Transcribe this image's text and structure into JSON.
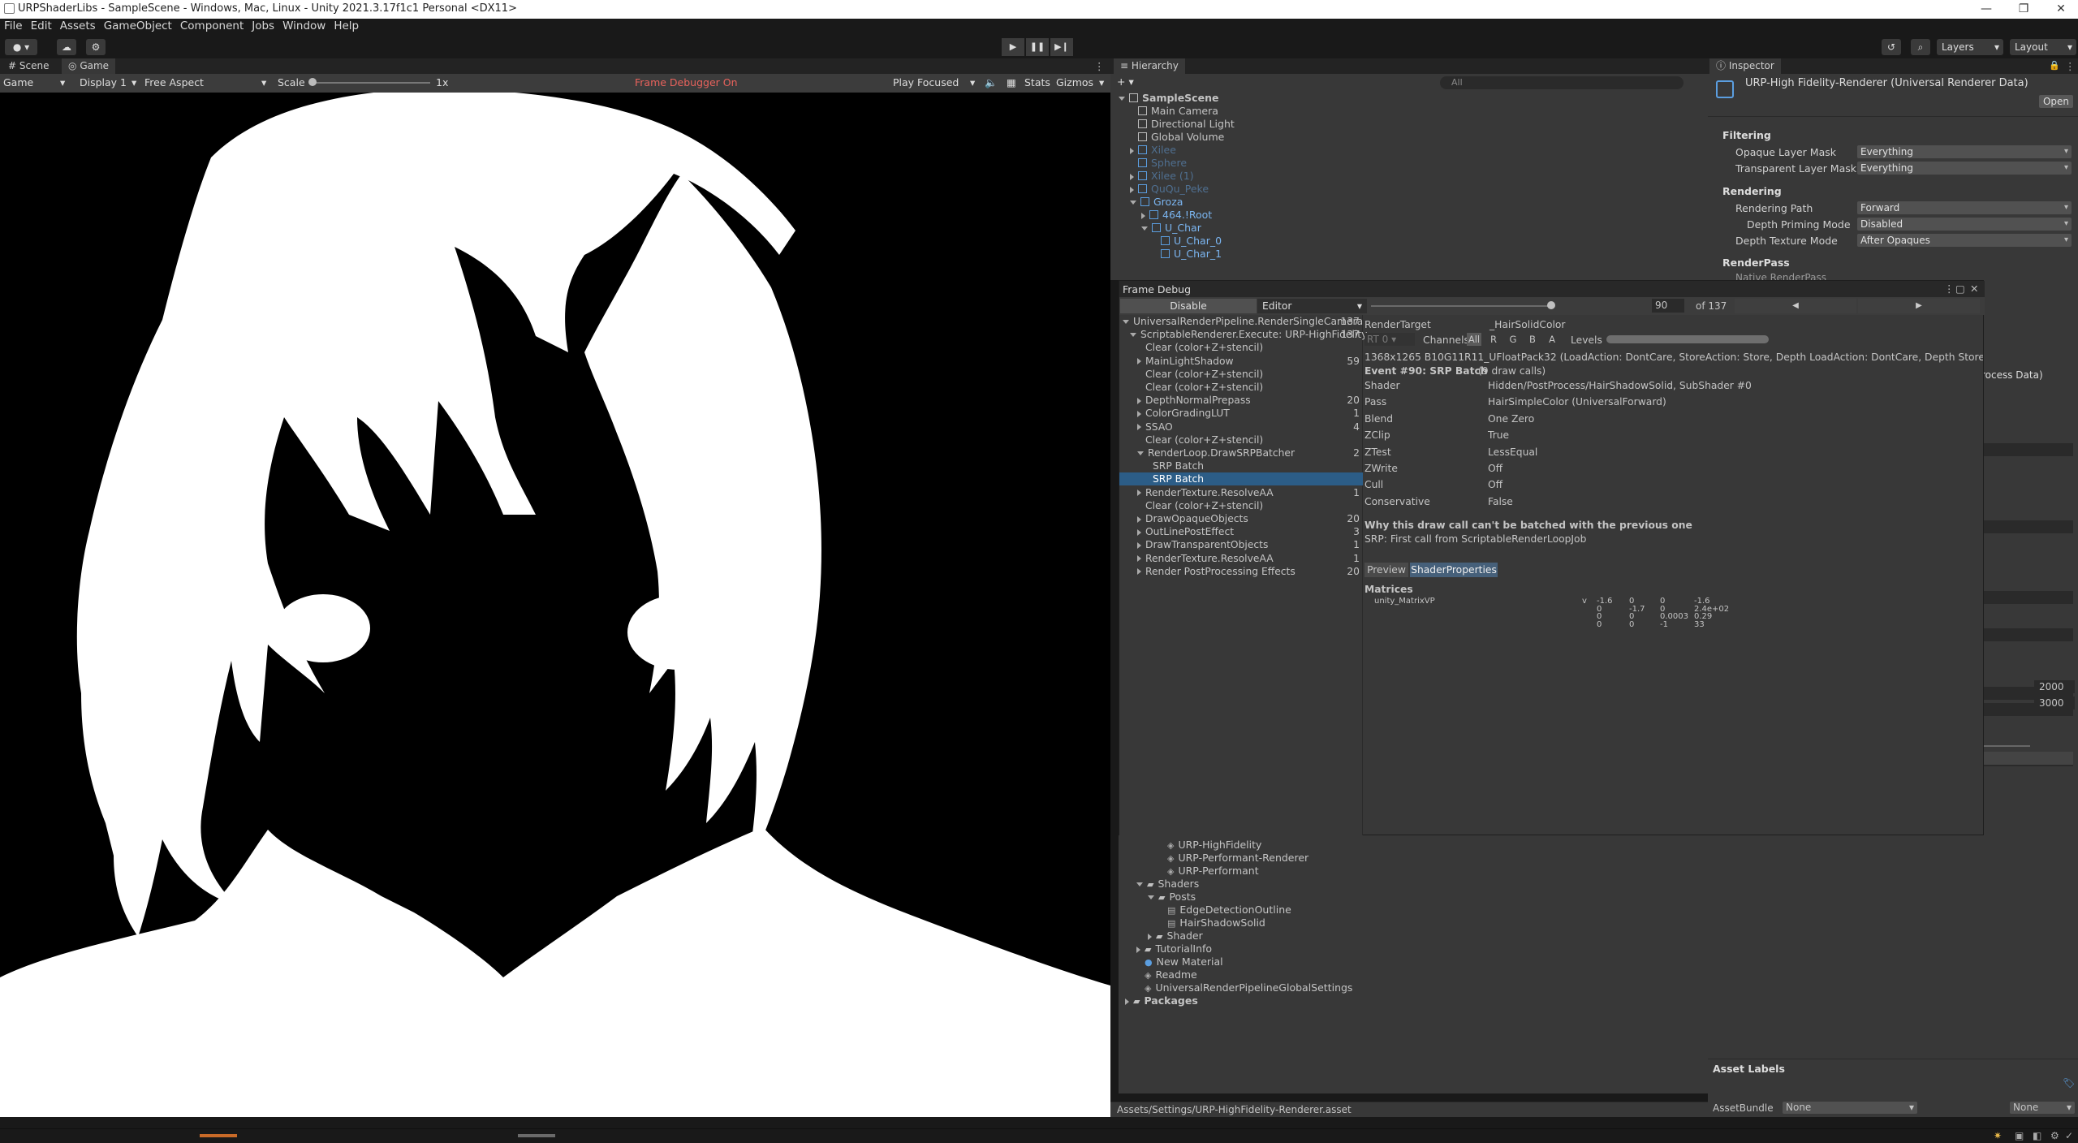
{
  "window": {
    "title": "URPShaderLibs - SampleScene - Windows, Mac, Linux - Unity 2021.3.17f1c1 Personal <DX11>"
  },
  "menu": [
    "File",
    "Edit",
    "Assets",
    "GameObject",
    "Component",
    "Jobs",
    "Window",
    "Help"
  ],
  "toolbar": {
    "layers": "Layers",
    "layout": "Layout"
  },
  "tabs": {
    "scene": "Scene",
    "game": "Game",
    "hierarchy": "Hierarchy",
    "inspector": "Inspector"
  },
  "gamebar": {
    "mode": "Game",
    "display": "Display 1",
    "aspect": "Free Aspect",
    "scale_label": "Scale",
    "scale_value": "1x",
    "frame_debugger": "Frame Debugger On",
    "play_focused": "Play Focused",
    "stats": "Stats",
    "gizmos": "Gizmos"
  },
  "hierarchy": {
    "search_placeholder": "All",
    "items": [
      {
        "label": "SampleScene",
        "depth": 0,
        "bold": true,
        "expanded": true
      },
      {
        "label": "Main Camera",
        "depth": 1
      },
      {
        "label": "Directional Light",
        "depth": 1
      },
      {
        "label": "Global Volume",
        "depth": 1
      },
      {
        "label": "Xilee",
        "depth": 1,
        "dim": true,
        "arrow": true
      },
      {
        "label": "Sphere",
        "depth": 1,
        "dim": true
      },
      {
        "label": "Xilee (1)",
        "depth": 1,
        "dim": true,
        "arrow": true
      },
      {
        "label": "QuQu_Peke",
        "depth": 1,
        "dim": true,
        "arrow": true
      },
      {
        "label": "Groza",
        "depth": 1,
        "blue": true,
        "expanded": true
      },
      {
        "label": "464.!Root",
        "depth": 2,
        "blue": true,
        "arrow": true
      },
      {
        "label": "U_Char",
        "depth": 2,
        "blue": true,
        "expanded": true
      },
      {
        "label": "U_Char_0",
        "depth": 3,
        "blue": true
      },
      {
        "label": "U_Char_1",
        "depth": 3,
        "blue": true
      }
    ]
  },
  "inspector": {
    "title": "URP-High Fidelity-Renderer (Universal Renderer Data)",
    "open": "Open",
    "filtering": "Filtering",
    "opaque_label": "Opaque Layer Mask",
    "opaque_value": "Everything",
    "transparent_label": "Transparent Layer Mask",
    "transparent_value": "Everything",
    "rendering": "Rendering",
    "path_label": "Rendering Path",
    "path_value": "Forward",
    "priming_label": "Depth Priming Mode",
    "priming_value": "Disabled",
    "texmode_label": "Depth Texture Mode",
    "texmode_value": "After Opaques",
    "renderpass": "RenderPass",
    "native_label": "Native RenderPass",
    "process_data": "rocess Data)",
    "val_2000": "2000",
    "val_3000": "3000",
    "asset_labels": "Asset Labels",
    "assetbundle_label": "AssetBundle",
    "assetbundle_value": "None",
    "variant_value": "None"
  },
  "frame_debug": {
    "title": "Frame Debug",
    "disable": "Disable",
    "editor": "Editor",
    "event_index": "90",
    "event_total": "of 137",
    "tree": [
      {
        "label": "UniversalRenderPipeline.RenderSingleCamera",
        "count": "137",
        "depth": 0,
        "expanded": true
      },
      {
        "label": "ScriptableRenderer.Execute: URP-HighFidelity",
        "count": "137",
        "depth": 1,
        "expanded": true
      },
      {
        "label": "Clear (color+Z+stencil)",
        "count": "",
        "depth": 2
      },
      {
        "label": "MainLightShadow",
        "count": "59",
        "depth": 2,
        "arrow": true
      },
      {
        "label": "Clear (color+Z+stencil)",
        "count": "",
        "depth": 2
      },
      {
        "label": "Clear (color+Z+stencil)",
        "count": "",
        "depth": 2
      },
      {
        "label": "DepthNormalPrepass",
        "count": "20",
        "depth": 2,
        "arrow": true
      },
      {
        "label": "ColorGradingLUT",
        "count": "1",
        "depth": 2,
        "arrow": true
      },
      {
        "label": "SSAO",
        "count": "4",
        "depth": 2,
        "arrow": true
      },
      {
        "label": "Clear (color+Z+stencil)",
        "count": "",
        "depth": 2
      },
      {
        "label": "RenderLoop.DrawSRPBatcher",
        "count": "2",
        "depth": 2,
        "expanded": true
      },
      {
        "label": "SRP Batch",
        "count": "",
        "depth": 3
      },
      {
        "label": "SRP Batch",
        "count": "",
        "depth": 3,
        "selected": true
      },
      {
        "label": "RenderTexture.ResolveAA",
        "count": "1",
        "depth": 2,
        "arrow": true
      },
      {
        "label": "Clear (color+Z+stencil)",
        "count": "",
        "depth": 2
      },
      {
        "label": "DrawOpaqueObjects",
        "count": "20",
        "depth": 2,
        "arrow": true
      },
      {
        "label": "OutLinePostEffect",
        "count": "3",
        "depth": 2,
        "arrow": true
      },
      {
        "label": "DrawTransparentObjects",
        "count": "1",
        "depth": 2,
        "arrow": true
      },
      {
        "label": "RenderTexture.ResolveAA",
        "count": "1",
        "depth": 2,
        "arrow": true
      },
      {
        "label": "Render PostProcessing Effects",
        "count": "20",
        "depth": 2,
        "arrow": true
      }
    ],
    "render_target_label": "RenderTarget",
    "render_target_value": "_HairSolidColor",
    "rt": "RT 0",
    "channels_label": "Channels",
    "channels": [
      "All",
      "R",
      "G",
      "B",
      "A"
    ],
    "levels_label": "Levels",
    "format_line": "1368x1265 B10G11R11_UFloatPack32 (LoadAction: DontCare, StoreAction: Store, Depth LoadAction: DontCare, Depth StoreAction: Sto",
    "event_title": "Event #90: SRP Batch",
    "event_calls": "(9 draw calls)",
    "props": [
      {
        "k": "Shader",
        "v": "Hidden/PostProcess/HairShadowSolid, SubShader #0"
      },
      {
        "k": "Pass",
        "v": "HairSimpleColor (UniversalForward)"
      },
      {
        "k": "Blend",
        "v": "One Zero"
      },
      {
        "k": "ZClip",
        "v": "True"
      },
      {
        "k": "ZTest",
        "v": "LessEqual"
      },
      {
        "k": "ZWrite",
        "v": "Off"
      },
      {
        "k": "Cull",
        "v": "Off"
      },
      {
        "k": "Conservative",
        "v": "False"
      }
    ],
    "why_title": "Why this draw call can't be batched with the previous one",
    "why_text": "SRP: First call from ScriptableRenderLoopJob",
    "tab_preview": "Preview",
    "tab_props": "ShaderProperties",
    "matrices": "Matrices",
    "matrix_name": "unity_MatrixVP",
    "matrix_type": "v",
    "matrix": [
      [
        "-1.6",
        "0",
        "0",
        "-1.6"
      ],
      [
        "0",
        "-1.7",
        "0",
        "2.4e+02"
      ],
      [
        "0",
        "0",
        "0.0003",
        "0.29"
      ],
      [
        "0",
        "0",
        "-1",
        "33"
      ]
    ]
  },
  "project": {
    "items": [
      {
        "label": "URP-HighFidelity",
        "depth": 2,
        "icon": "asset"
      },
      {
        "label": "URP-Performant-Renderer",
        "depth": 2,
        "icon": "asset"
      },
      {
        "label": "URP-Performant",
        "depth": 2,
        "icon": "asset"
      },
      {
        "label": "Shaders",
        "depth": 0,
        "icon": "folder",
        "expanded": true
      },
      {
        "label": "Posts",
        "depth": 1,
        "icon": "folder",
        "expanded": true
      },
      {
        "label": "EdgeDetectionOutline",
        "depth": 2,
        "icon": "shader"
      },
      {
        "label": "HairShadowSolid",
        "depth": 2,
        "icon": "shader"
      },
      {
        "label": "Shader",
        "depth": 1,
        "icon": "folder",
        "arrow": true
      },
      {
        "label": "TutorialInfo",
        "depth": 0,
        "icon": "folder",
        "arrow": true
      },
      {
        "label": "New Material",
        "depth": 0,
        "icon": "material"
      },
      {
        "label": "Readme",
        "depth": 0,
        "icon": "asset"
      },
      {
        "label": "UniversalRenderPipelineGlobalSettings",
        "depth": 0,
        "icon": "asset"
      },
      {
        "label": "Packages",
        "depth": -1,
        "icon": "folder",
        "arrow": true,
        "bold": true
      }
    ],
    "path": "Assets/Settings/URP-HighFidelity-Renderer.asset"
  },
  "colors": {
    "selection": "#2c5d87",
    "blue_text": "#7bb5f0",
    "frame_debugger_text": "#e8625c"
  }
}
